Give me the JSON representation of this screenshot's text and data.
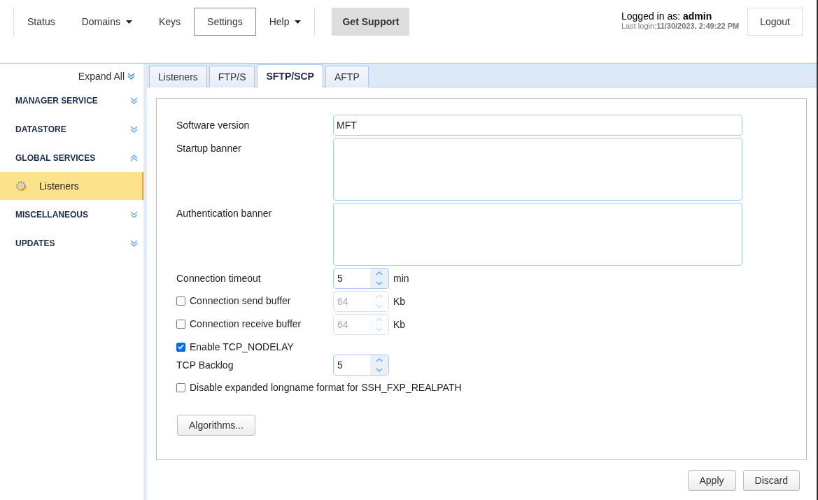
{
  "nav": {
    "items": [
      {
        "label": "Status",
        "dropdown": false,
        "selected": false
      },
      {
        "label": "Domains",
        "dropdown": true,
        "selected": false
      },
      {
        "label": "Keys",
        "dropdown": false,
        "selected": false
      },
      {
        "label": "Settings",
        "dropdown": false,
        "selected": true
      },
      {
        "label": "Help",
        "dropdown": true,
        "selected": false
      }
    ],
    "support_button": "Get Support"
  },
  "user": {
    "logged_in_label": "Logged in as:",
    "username": "admin",
    "last_login_label": "Last login:",
    "last_login": "11/30/2023, 2:49:22 PM",
    "logout": "Logout"
  },
  "sidebar": {
    "expand_all": "Expand All",
    "sections": [
      {
        "title": "MANAGER SERVICE",
        "expanded": false
      },
      {
        "title": "DATASTORE",
        "expanded": false
      },
      {
        "title": "GLOBAL SERVICES",
        "expanded": true,
        "children": [
          {
            "label": "Listeners",
            "selected": true
          }
        ]
      },
      {
        "title": "MISCELLANEOUS",
        "expanded": false
      },
      {
        "title": "UPDATES",
        "expanded": false
      }
    ]
  },
  "tabs": [
    {
      "label": "Listeners",
      "selected": false
    },
    {
      "label": "FTP/S",
      "selected": false
    },
    {
      "label": "SFTP/SCP",
      "selected": true
    },
    {
      "label": "AFTP",
      "selected": false
    }
  ],
  "form": [
    {
      "kind": "text",
      "label": "Software version",
      "value": "MFT"
    },
    {
      "kind": "textarea",
      "label": "Startup banner"
    },
    {
      "kind": "textarea",
      "label": "Authentication banner"
    },
    {
      "kind": "spinner",
      "label": "Connection timeout",
      "value": "5",
      "unit": "min"
    },
    {
      "kind": "checkbox_spinner",
      "label": "Connection send buffer",
      "checked": false,
      "value": "64",
      "unit": "Kb"
    },
    {
      "kind": "checkbox_spinner",
      "label": "Connection receive buffer",
      "checked": false,
      "value": "64",
      "unit": "Kb"
    },
    {
      "kind": "checkbox",
      "label": "Enable TCP_NODELAY",
      "checked": true
    },
    {
      "kind": "spinner",
      "label": "TCP Backlog",
      "value": "5"
    },
    {
      "kind": "checkbox",
      "label": "Disable expanded longname format for SSH_FXP_REALPATH",
      "checked": false
    }
  ],
  "algorithms_button": "Algorithms...",
  "footer_buttons": [
    "Apply",
    "Discard"
  ]
}
